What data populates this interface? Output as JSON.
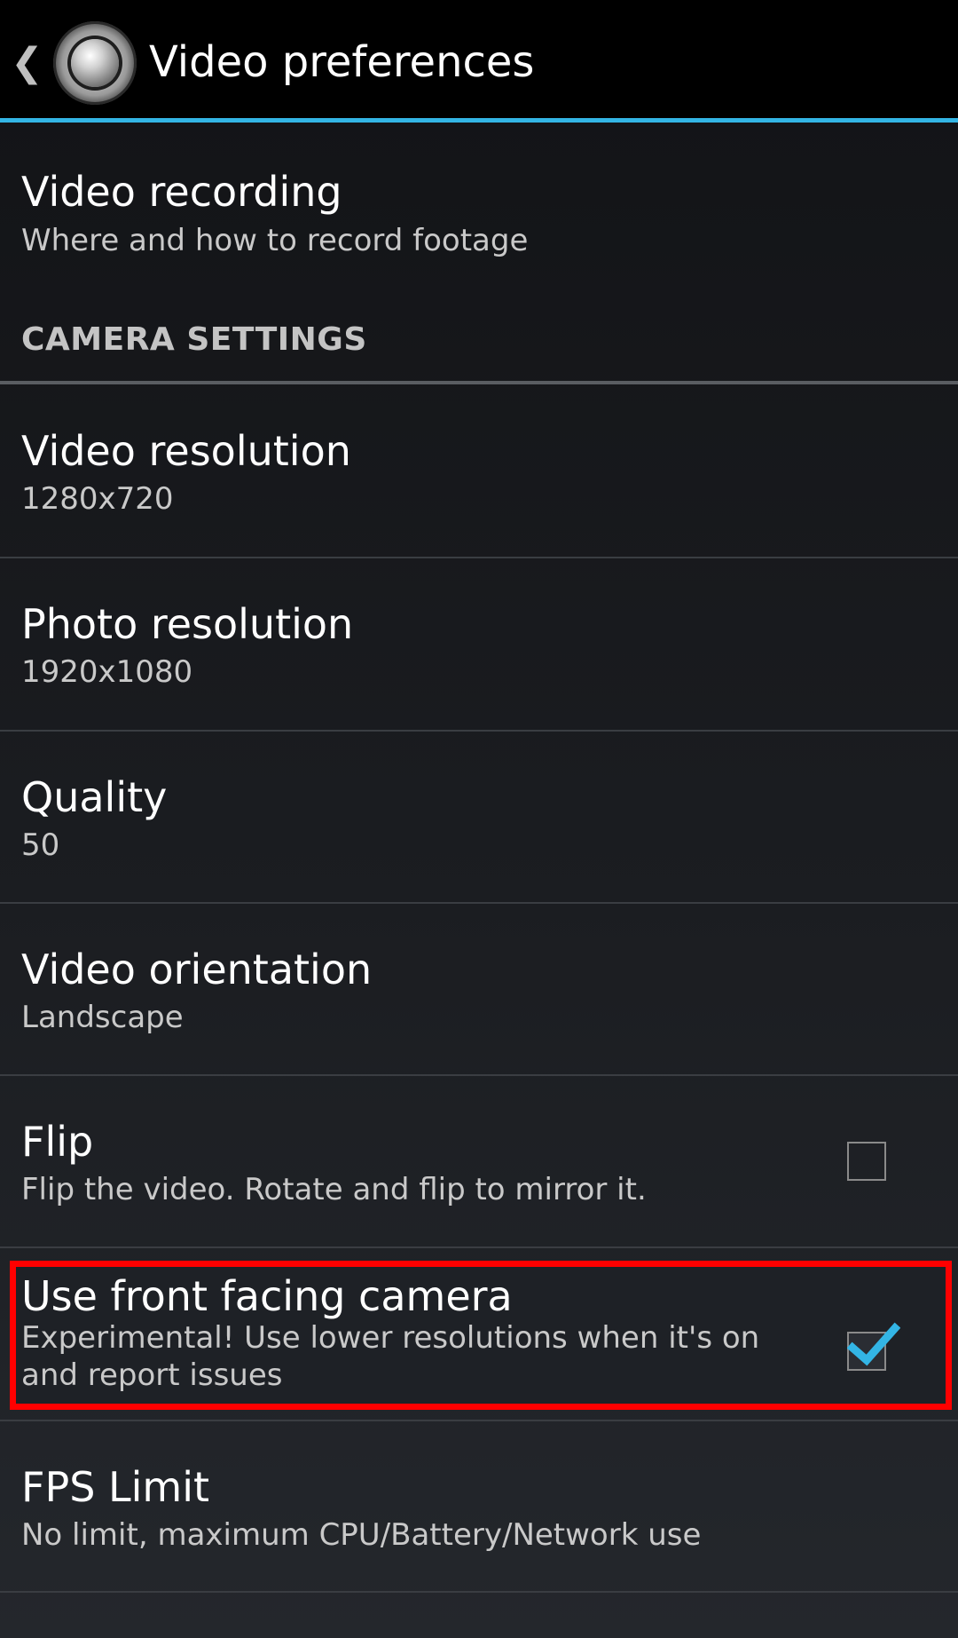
{
  "header": {
    "title": "Video preferences",
    "app_icon": "camera-lens-icon",
    "up_icon": "chevron-left-icon",
    "accent_color": "#33b5e5"
  },
  "video_recording": {
    "title": "Video recording",
    "summary": "Where and how to record footage"
  },
  "category": {
    "label": "CAMERA SETTINGS"
  },
  "items": [
    {
      "title": "Video resolution",
      "summary": "1280x720"
    },
    {
      "title": "Photo resolution",
      "summary": "1920x1080"
    },
    {
      "title": "Quality",
      "summary": "50"
    },
    {
      "title": "Video orientation",
      "summary": "Landscape"
    },
    {
      "title": "Flip",
      "summary": "Flip the video. Rotate and flip to mirror it.",
      "checked": false
    },
    {
      "title": "Use front facing camera",
      "summary": "Experimental! Use lower resolutions when it's on and report issues",
      "checked": true
    },
    {
      "title": "FPS Limit",
      "summary": "No limit, maximum CPU/Battery/Network use"
    }
  ],
  "highlight_color": "#ff0000",
  "check_color": "#33b5e5"
}
